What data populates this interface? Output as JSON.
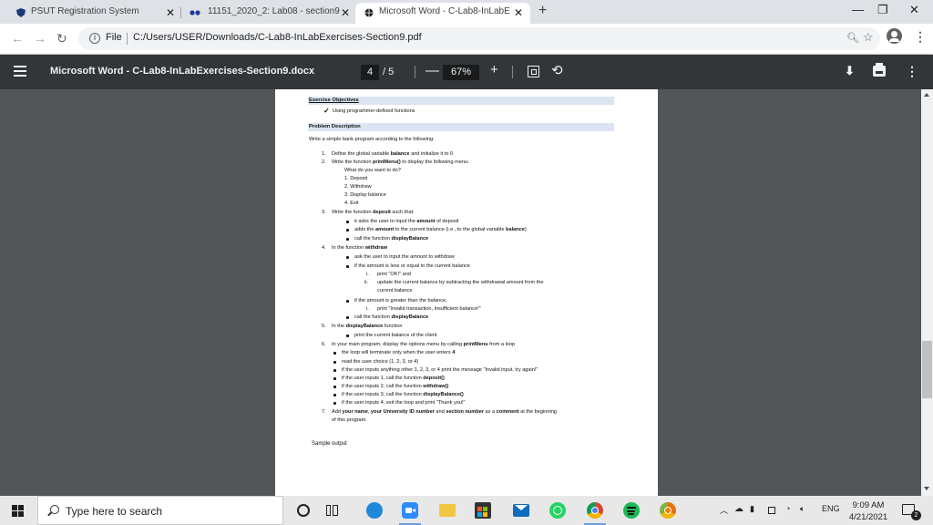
{
  "browser": {
    "tabs": [
      {
        "title": "PSUT Registration System",
        "active": false
      },
      {
        "title": "11151_2020_2: Lab08 - section9",
        "active": false
      },
      {
        "title": "Microsoft Word - C-Lab8-InLabE",
        "active": true
      }
    ],
    "new_tab": "+",
    "window_controls": {
      "minimize": "—",
      "restore": "❐",
      "close": "✕"
    },
    "address": {
      "scheme_label": "File",
      "url": "C:/Users/USER/Downloads/C-Lab8-InLabExercises-Section9.pdf"
    },
    "icons": {
      "back": "arrow-left-icon",
      "forward": "arrow-right-icon",
      "reload": "reload-icon",
      "info": "info-icon",
      "zoom": "zoom-icon",
      "bookmark": "star-icon",
      "profile": "avatar-icon",
      "menu": "kebab-menu-icon"
    }
  },
  "pdf_toolbar": {
    "title": "Microsoft Word - C-Lab8-InLabExercises-Section9.docx",
    "page_current": "4",
    "page_total": "/ 5",
    "zoom_minus": "—",
    "zoom": "67%",
    "zoom_plus": "+"
  },
  "document": {
    "h_objectives": "Exercise Objectives",
    "objective": "Using programmer-defined functions",
    "h_problem": "Problem Description",
    "intro": "Write a simple bank program according to the following:",
    "l1_n": "1.",
    "l1_a": "Define the global variable ",
    "l1_b": "balance",
    "l1_c": " and initialize it to 0",
    "l2_n": "2.",
    "l2_a": "Write the function ",
    "l2_b": "printMenu()",
    "l2_c": " to display the following menu:",
    "menu_q": "What do you want to do?",
    "menu_1": "1. Deposit",
    "menu_2": "2. Withdraw",
    "menu_3": "3. Display balance",
    "menu_4": "4. Exit",
    "l3_n": "3.",
    "l3_a": "Write the function ",
    "l3_b": "deposit",
    "l3_c": " such that:",
    "l3_b1_a": "it asks the user to input the ",
    "l3_b1_b": "amount",
    "l3_b1_c": " of deposit",
    "l3_b2_a": "adds the ",
    "l3_b2_b": "amount",
    "l3_b2_c": " to the current balance (i.e., to the global variable ",
    "l3_b2_d": "balance",
    "l3_b2_e": ")",
    "l3_b3_a": "call the function ",
    "l3_b3_b": "displayBalance",
    "l4_n": "4.",
    "l4_a": "In the function ",
    "l4_b": "withdraw",
    "l4_b1": "ask the user to input the amount to withdraw",
    "l4_b2": "if the amount is less or equal to the current balance",
    "l4_r1_n": "i.",
    "l4_r1": "print \"OK!\" and",
    "l4_r2_n": "ii.",
    "l4_r2_a": "update the current balance by subtracting the withdrawal amount from the",
    "l4_r2_b": "current balance",
    "l4_b3": "if the amount is greater than the balance,",
    "l4_r3_n": "i.",
    "l4_r3": "print \"Invalid transaction, insufficient balance!\"",
    "l4_b4_a": "call the function ",
    "l4_b4_b": "displayBalance",
    "l5_n": "5.",
    "l5_a": "In the ",
    "l5_b": "displayBalance",
    "l5_c": " function",
    "l5_b1": "print the current balance of the client",
    "l6_n": "6.",
    "l6_a": "In your main program, display the options menu by calling ",
    "l6_b": "printMenu",
    "l6_c": " from a loop",
    "l6_b1_a": "the loop will terminate only when the user enters ",
    "l6_b1_b": "4",
    "l6_b2": "read the user choice (1, 2, 3, or 4)",
    "l6_b3": "if the user inputs anything other 1, 2, 3, or 4 print the message \"Invalid input, try again!\"",
    "l6_b4_a": "if the user inputs 1, call the function ",
    "l6_b4_b": "deposit()",
    "l6_b5_a": "if the user inputs 2, call the function ",
    "l6_b5_b": "withdraw()",
    "l6_b6_a": "if the user inputs 3, call the function ",
    "l6_b6_b": "displayBalance()",
    "l6_b7": "if the user inputs 4, exit the loop and print \"Thank you!\"",
    "l7_n": "7.",
    "l7_a": "Add ",
    "l7_b": "your name",
    "l7_c": ", ",
    "l7_d": "your University ID number",
    "l7_e": " and ",
    "l7_f": "section number",
    "l7_g": " as a ",
    "l7_h": "comment",
    "l7_i": " at the beginning",
    "l7_cont": "of this program.",
    "sample": "Sample output"
  },
  "taskbar": {
    "search_placeholder": "Type here to search",
    "language": "ENG",
    "time": "9:09 AM",
    "date": "4/21/2021",
    "notification_count": "2",
    "apps": [
      "cortana-icon",
      "task-view-icon",
      "edge-icon",
      "zoom-icon",
      "file-explorer-icon",
      "store-icon",
      "mail-icon",
      "whatsapp-icon",
      "chrome-icon",
      "spotify-icon",
      "chrome-canary-icon"
    ]
  },
  "colors": {
    "pdf_toolbar": "#323639",
    "viewer_bg": "#525659",
    "heading_bg": "#dbe5f1",
    "tab_strip": "#dee1e6"
  }
}
